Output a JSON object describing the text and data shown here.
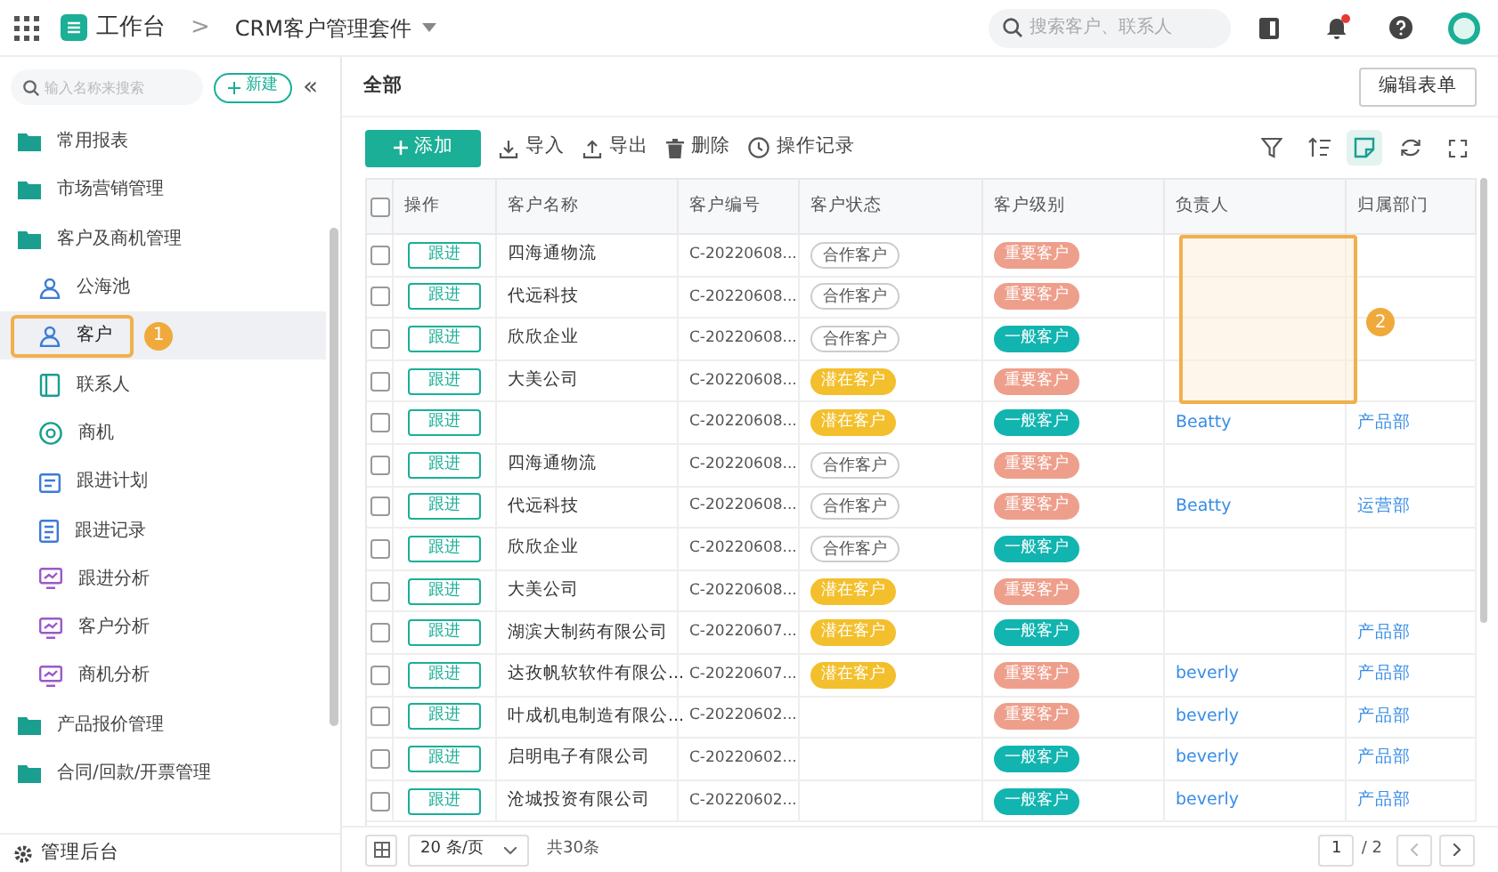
{
  "topbar": {
    "home": "工作台",
    "separator": ">",
    "app": "CRM客户管理套件",
    "search": {
      "placeholder": "搜索客户、联系人"
    },
    "notification_dot": true
  },
  "sidebar": {
    "search": {
      "placeholder": "输入名称来搜索"
    },
    "new_button": "新建",
    "collapse": "«",
    "items": [
      {
        "label": "常用报表",
        "kind": "folder",
        "selected": false
      },
      {
        "label": "市场营销管理",
        "kind": "folder",
        "selected": false
      },
      {
        "label": "客户及商机管理",
        "kind": "folder",
        "selected": false,
        "children": [
          {
            "label": "公海池",
            "kind": "person",
            "selected": false
          },
          {
            "label": "客户",
            "kind": "person",
            "selected": true,
            "annotation": "1"
          },
          {
            "label": "联系人",
            "kind": "contact",
            "selected": false
          },
          {
            "label": "商机",
            "kind": "target",
            "selected": false
          },
          {
            "label": "跟进计划",
            "kind": "calendar",
            "selected": false
          },
          {
            "label": "跟进记录",
            "kind": "doc",
            "selected": false
          },
          {
            "label": "跟进分析",
            "kind": "monitor",
            "selected": false
          },
          {
            "label": "客户分析",
            "kind": "monitor",
            "selected": false
          },
          {
            "label": "商机分析",
            "kind": "monitor",
            "selected": false
          }
        ]
      },
      {
        "label": "产品报价管理",
        "kind": "folder",
        "selected": false
      },
      {
        "label": "合同/回款/开票管理",
        "kind": "folder",
        "selected": false
      }
    ],
    "footer": "管理后台"
  },
  "view": {
    "title": "全部",
    "edit_button": "编辑表单"
  },
  "toolbar": {
    "add": "添加",
    "actions": [
      {
        "label": "导入",
        "kind": "import"
      },
      {
        "label": "导出",
        "kind": "export"
      },
      {
        "label": "删除",
        "kind": "trash"
      },
      {
        "label": "操作记录",
        "kind": "clock"
      }
    ],
    "tools": [
      {
        "kind": "filter",
        "selected": false
      },
      {
        "kind": "sort",
        "selected": false
      },
      {
        "kind": "note",
        "selected": true
      },
      {
        "kind": "refresh",
        "selected": false
      },
      {
        "kind": "fullscreen",
        "selected": false
      }
    ]
  },
  "table": {
    "select_all_checked": false,
    "columns": [
      "操作",
      "客户名称",
      "客户编号",
      "客户状态",
      "客户级别",
      "负责人",
      "归属部门"
    ],
    "owner_annotation": "2",
    "rows": [
      {
        "checked": false,
        "action": "跟进",
        "name": "四海通物流",
        "code": "C-20220608...",
        "status": {
          "kind": "partner",
          "label": "合作客户"
        },
        "level": {
          "kind": "important",
          "label": "重要客户"
        }
      },
      {
        "checked": false,
        "action": "跟进",
        "name": "代远科技",
        "code": "C-20220608...",
        "status": {
          "kind": "partner",
          "label": "合作客户"
        },
        "level": {
          "kind": "important",
          "label": "重要客户"
        }
      },
      {
        "checked": false,
        "action": "跟进",
        "name": "欣欣企业",
        "code": "C-20220608...",
        "status": {
          "kind": "partner",
          "label": "合作客户"
        },
        "level": {
          "kind": "normal",
          "label": "一般客户"
        }
      },
      {
        "checked": false,
        "action": "跟进",
        "name": "大美公司",
        "code": "C-20220608...",
        "status": {
          "kind": "potential",
          "label": "潜在客户"
        },
        "level": {
          "kind": "important",
          "label": "重要客户"
        }
      },
      {
        "checked": false,
        "action": "跟进",
        "code": "C-20220608...",
        "status": {
          "kind": "potential",
          "label": "潜在客户"
        },
        "level": {
          "kind": "normal",
          "label": "一般客户"
        },
        "owner": "Beatty",
        "dept": "产品部"
      },
      {
        "checked": false,
        "action": "跟进",
        "name": "四海通物流",
        "code": "C-20220608...",
        "status": {
          "kind": "partner",
          "label": "合作客户"
        },
        "level": {
          "kind": "important",
          "label": "重要客户"
        }
      },
      {
        "checked": false,
        "action": "跟进",
        "name": "代远科技",
        "code": "C-20220608...",
        "status": {
          "kind": "partner",
          "label": "合作客户"
        },
        "level": {
          "kind": "important",
          "label": "重要客户"
        },
        "owner": "Beatty",
        "dept": "运营部"
      },
      {
        "checked": false,
        "action": "跟进",
        "name": "欣欣企业",
        "code": "C-20220608...",
        "status": {
          "kind": "partner",
          "label": "合作客户"
        },
        "level": {
          "kind": "normal",
          "label": "一般客户"
        }
      },
      {
        "checked": false,
        "action": "跟进",
        "name": "大美公司",
        "code": "C-20220608...",
        "status": {
          "kind": "potential",
          "label": "潜在客户"
        },
        "level": {
          "kind": "important",
          "label": "重要客户"
        }
      },
      {
        "checked": false,
        "action": "跟进",
        "name": "湖滨大制药有限公司",
        "code": "C-20220607...",
        "status": {
          "kind": "potential",
          "label": "潜在客户"
        },
        "level": {
          "kind": "normal",
          "label": "一般客户"
        },
        "dept": "产品部"
      },
      {
        "checked": false,
        "action": "跟进",
        "name": "达孜帆软软件有限公...",
        "code": "C-20220607...",
        "status": {
          "kind": "potential",
          "label": "潜在客户"
        },
        "level": {
          "kind": "important",
          "label": "重要客户"
        },
        "owner": "beverly",
        "dept": "产品部"
      },
      {
        "checked": false,
        "action": "跟进",
        "name": "叶成机电制造有限公...",
        "code": "C-20220602...",
        "level": {
          "kind": "important",
          "label": "重要客户"
        },
        "owner": "beverly",
        "dept": "产品部"
      },
      {
        "checked": false,
        "action": "跟进",
        "name": "启明电子有限公司",
        "code": "C-20220602...",
        "level": {
          "kind": "normal",
          "label": "一般客户"
        },
        "owner": "beverly",
        "dept": "产品部"
      },
      {
        "checked": false,
        "action": "跟进",
        "name": "沧城投资有限公司",
        "code": "C-20220602...",
        "level": {
          "kind": "normal",
          "label": "一般客户"
        },
        "owner": "beverly",
        "dept": "产品部"
      }
    ]
  },
  "pagination": {
    "page_size": "20 条/页",
    "total": "共30条",
    "page": "1",
    "pages": "/ 2"
  }
}
